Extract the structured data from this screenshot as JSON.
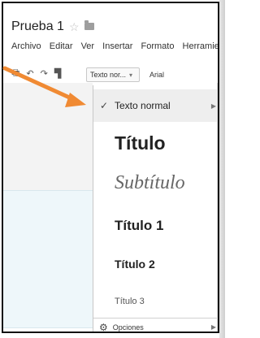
{
  "document": {
    "title": "Prueba 1"
  },
  "menubar": [
    "Archivo",
    "Editar",
    "Ver",
    "Insertar",
    "Formato",
    "Herramientas"
  ],
  "toolbar": {
    "style_select": "Texto nor...",
    "font_select": "Arial"
  },
  "styles_menu": {
    "items": [
      {
        "label": "Texto normal",
        "selected": true
      },
      {
        "label": "Título"
      },
      {
        "label": "Subtítulo"
      },
      {
        "label": "Título 1"
      },
      {
        "label": "Título 2"
      },
      {
        "label": "Título 3"
      }
    ],
    "footer_label": "Opciones"
  },
  "colors": {
    "arrow": "#f08a33",
    "menu_selected_bg": "#eeeeee"
  }
}
